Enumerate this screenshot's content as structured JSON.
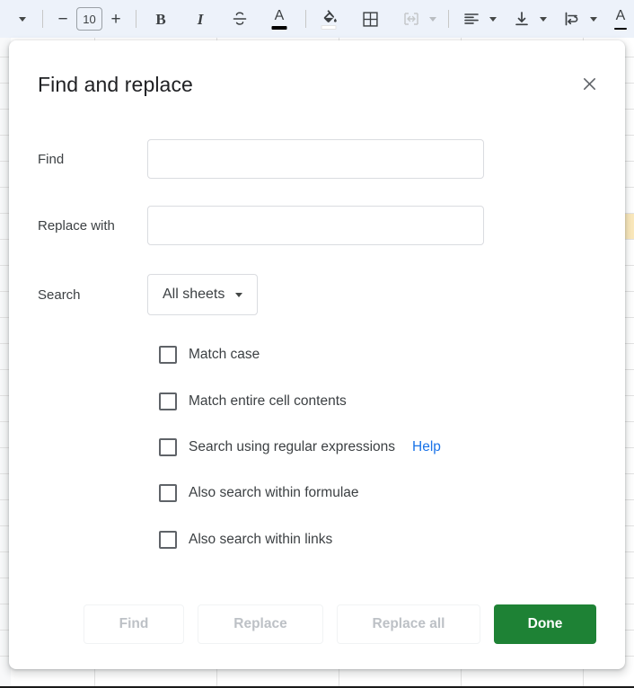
{
  "toolbar": {
    "items": [
      {
        "name": "font-menu-caret",
        "icon": "chevron-down-icon",
        "label": ""
      },
      {
        "name": "separator-1",
        "icon": "separator",
        "label": ""
      },
      {
        "name": "decrease-font-size",
        "icon": "minus-icon",
        "label": "−"
      },
      {
        "name": "font-size-field",
        "icon": "textbox",
        "label": "10"
      },
      {
        "name": "increase-font-size",
        "icon": "plus-icon",
        "label": "+"
      },
      {
        "name": "separator-2",
        "icon": "separator",
        "label": ""
      },
      {
        "name": "bold",
        "icon": "bold-icon",
        "label": "B"
      },
      {
        "name": "italic",
        "icon": "italic-icon",
        "label": "I"
      },
      {
        "name": "strikethrough",
        "icon": "strikethrough-icon",
        "label": "S"
      },
      {
        "name": "text-color",
        "icon": "text-color-icon",
        "label": "A"
      },
      {
        "name": "separator-3",
        "icon": "separator",
        "label": ""
      },
      {
        "name": "fill-color",
        "icon": "paint-bucket-icon",
        "label": ""
      },
      {
        "name": "borders",
        "icon": "borders-grid-icon",
        "label": ""
      },
      {
        "name": "merge-cells",
        "icon": "merge-cells-icon",
        "label": ""
      },
      {
        "name": "merge-cells-caret",
        "icon": "chevron-down-icon",
        "label": ""
      },
      {
        "name": "separator-4",
        "icon": "separator",
        "label": ""
      },
      {
        "name": "horizontal-align",
        "icon": "align-left-icon",
        "label": ""
      },
      {
        "name": "horizontal-align-caret",
        "icon": "chevron-down-icon",
        "label": ""
      },
      {
        "name": "vertical-align",
        "icon": "vertical-align-bottom-icon",
        "label": ""
      },
      {
        "name": "vertical-align-caret",
        "icon": "chevron-down-icon",
        "label": ""
      },
      {
        "name": "text-wrapping",
        "icon": "text-wrap-icon",
        "label": ""
      },
      {
        "name": "text-wrapping-caret",
        "icon": "chevron-down-icon",
        "label": ""
      },
      {
        "name": "text-rotation",
        "icon": "text-rotation-icon",
        "label": "A"
      }
    ],
    "font_size_value": "10",
    "background": "#edf2fa"
  },
  "sheet": {
    "highlight_cell_color": "#fbe9bc",
    "grid_line_color": "#e3e3e3",
    "gutter_color": "#f8f9fa"
  },
  "dialog": {
    "title": "Find and replace",
    "close_icon": "close-icon",
    "fields": [
      {
        "label": "Find",
        "value": "",
        "placeholder": ""
      },
      {
        "label": "Replace with",
        "value": "",
        "placeholder": ""
      }
    ],
    "search": {
      "label": "Search",
      "selected": "All sheets",
      "caret_icon": "chevron-down-icon"
    },
    "checkboxes": [
      {
        "label": "Match case",
        "checked": false,
        "link": null
      },
      {
        "label": "Match entire cell contents",
        "checked": false,
        "link": null
      },
      {
        "label": "Search using regular expressions",
        "checked": false,
        "link": "Help"
      },
      {
        "label": "Also search within formulae",
        "checked": false,
        "link": null
      },
      {
        "label": "Also search within links",
        "checked": false,
        "link": null
      }
    ],
    "buttons": {
      "find": "Find",
      "replace": "Replace",
      "replace_all": "Replace all",
      "done": "Done"
    },
    "colors": {
      "primary": "#1e8235",
      "link": "#1a73e8",
      "disabled_text": "#bdc1c6",
      "title_text": "#202124"
    }
  }
}
